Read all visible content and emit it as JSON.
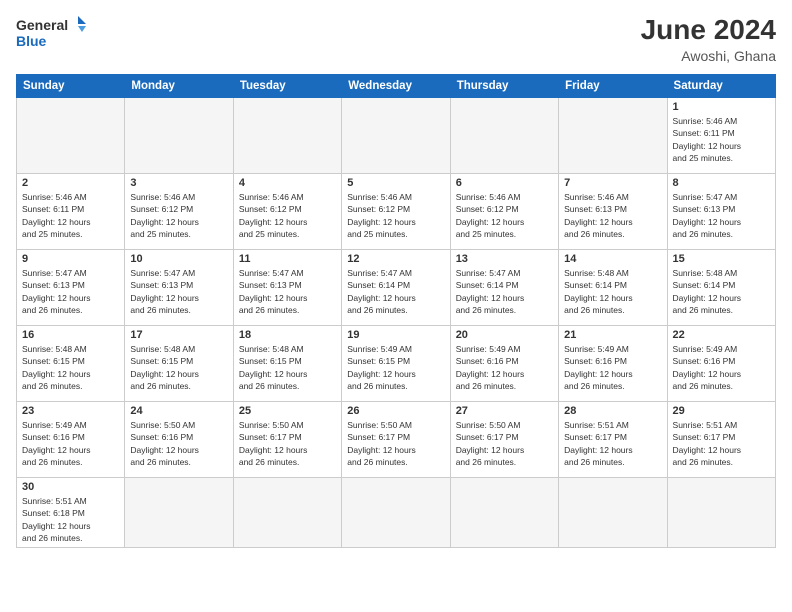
{
  "logo": {
    "text_general": "General",
    "text_blue": "Blue"
  },
  "title": {
    "month_year": "June 2024",
    "location": "Awoshi, Ghana"
  },
  "days_of_week": [
    "Sunday",
    "Monday",
    "Tuesday",
    "Wednesday",
    "Thursday",
    "Friday",
    "Saturday"
  ],
  "weeks": [
    [
      {
        "day": "",
        "info": ""
      },
      {
        "day": "",
        "info": ""
      },
      {
        "day": "",
        "info": ""
      },
      {
        "day": "",
        "info": ""
      },
      {
        "day": "",
        "info": ""
      },
      {
        "day": "",
        "info": ""
      },
      {
        "day": "1",
        "info": "Sunrise: 5:46 AM\nSunset: 6:11 PM\nDaylight: 12 hours\nand 25 minutes."
      }
    ],
    [
      {
        "day": "2",
        "info": "Sunrise: 5:46 AM\nSunset: 6:11 PM\nDaylight: 12 hours\nand 25 minutes."
      },
      {
        "day": "3",
        "info": "Sunrise: 5:46 AM\nSunset: 6:12 PM\nDaylight: 12 hours\nand 25 minutes."
      },
      {
        "day": "4",
        "info": "Sunrise: 5:46 AM\nSunset: 6:12 PM\nDaylight: 12 hours\nand 25 minutes."
      },
      {
        "day": "5",
        "info": "Sunrise: 5:46 AM\nSunset: 6:12 PM\nDaylight: 12 hours\nand 25 minutes."
      },
      {
        "day": "6",
        "info": "Sunrise: 5:46 AM\nSunset: 6:12 PM\nDaylight: 12 hours\nand 25 minutes."
      },
      {
        "day": "7",
        "info": "Sunrise: 5:46 AM\nSunset: 6:13 PM\nDaylight: 12 hours\nand 26 minutes."
      },
      {
        "day": "8",
        "info": "Sunrise: 5:47 AM\nSunset: 6:13 PM\nDaylight: 12 hours\nand 26 minutes."
      }
    ],
    [
      {
        "day": "9",
        "info": "Sunrise: 5:47 AM\nSunset: 6:13 PM\nDaylight: 12 hours\nand 26 minutes."
      },
      {
        "day": "10",
        "info": "Sunrise: 5:47 AM\nSunset: 6:13 PM\nDaylight: 12 hours\nand 26 minutes."
      },
      {
        "day": "11",
        "info": "Sunrise: 5:47 AM\nSunset: 6:13 PM\nDaylight: 12 hours\nand 26 minutes."
      },
      {
        "day": "12",
        "info": "Sunrise: 5:47 AM\nSunset: 6:14 PM\nDaylight: 12 hours\nand 26 minutes."
      },
      {
        "day": "13",
        "info": "Sunrise: 5:47 AM\nSunset: 6:14 PM\nDaylight: 12 hours\nand 26 minutes."
      },
      {
        "day": "14",
        "info": "Sunrise: 5:48 AM\nSunset: 6:14 PM\nDaylight: 12 hours\nand 26 minutes."
      },
      {
        "day": "15",
        "info": "Sunrise: 5:48 AM\nSunset: 6:14 PM\nDaylight: 12 hours\nand 26 minutes."
      }
    ],
    [
      {
        "day": "16",
        "info": "Sunrise: 5:48 AM\nSunset: 6:15 PM\nDaylight: 12 hours\nand 26 minutes."
      },
      {
        "day": "17",
        "info": "Sunrise: 5:48 AM\nSunset: 6:15 PM\nDaylight: 12 hours\nand 26 minutes."
      },
      {
        "day": "18",
        "info": "Sunrise: 5:48 AM\nSunset: 6:15 PM\nDaylight: 12 hours\nand 26 minutes."
      },
      {
        "day": "19",
        "info": "Sunrise: 5:49 AM\nSunset: 6:15 PM\nDaylight: 12 hours\nand 26 minutes."
      },
      {
        "day": "20",
        "info": "Sunrise: 5:49 AM\nSunset: 6:16 PM\nDaylight: 12 hours\nand 26 minutes."
      },
      {
        "day": "21",
        "info": "Sunrise: 5:49 AM\nSunset: 6:16 PM\nDaylight: 12 hours\nand 26 minutes."
      },
      {
        "day": "22",
        "info": "Sunrise: 5:49 AM\nSunset: 6:16 PM\nDaylight: 12 hours\nand 26 minutes."
      }
    ],
    [
      {
        "day": "23",
        "info": "Sunrise: 5:49 AM\nSunset: 6:16 PM\nDaylight: 12 hours\nand 26 minutes."
      },
      {
        "day": "24",
        "info": "Sunrise: 5:50 AM\nSunset: 6:16 PM\nDaylight: 12 hours\nand 26 minutes."
      },
      {
        "day": "25",
        "info": "Sunrise: 5:50 AM\nSunset: 6:17 PM\nDaylight: 12 hours\nand 26 minutes."
      },
      {
        "day": "26",
        "info": "Sunrise: 5:50 AM\nSunset: 6:17 PM\nDaylight: 12 hours\nand 26 minutes."
      },
      {
        "day": "27",
        "info": "Sunrise: 5:50 AM\nSunset: 6:17 PM\nDaylight: 12 hours\nand 26 minutes."
      },
      {
        "day": "28",
        "info": "Sunrise: 5:51 AM\nSunset: 6:17 PM\nDaylight: 12 hours\nand 26 minutes."
      },
      {
        "day": "29",
        "info": "Sunrise: 5:51 AM\nSunset: 6:17 PM\nDaylight: 12 hours\nand 26 minutes."
      }
    ],
    [
      {
        "day": "30",
        "info": "Sunrise: 5:51 AM\nSunset: 6:18 PM\nDaylight: 12 hours\nand 26 minutes."
      },
      {
        "day": "",
        "info": ""
      },
      {
        "day": "",
        "info": ""
      },
      {
        "day": "",
        "info": ""
      },
      {
        "day": "",
        "info": ""
      },
      {
        "day": "",
        "info": ""
      },
      {
        "day": "",
        "info": ""
      }
    ]
  ]
}
